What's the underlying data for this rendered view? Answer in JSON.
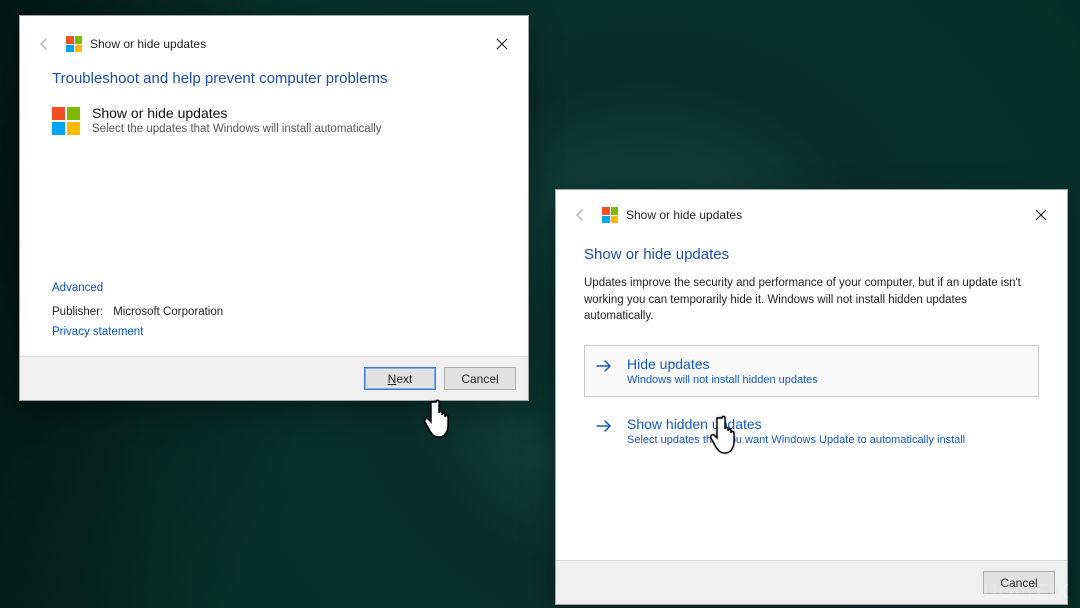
{
  "dialog1": {
    "title": "Show or hide updates",
    "heading": "Troubleshoot and help prevent computer problems",
    "section_title": "Show or hide updates",
    "section_desc": "Select the updates that Windows will install automatically",
    "advanced": "Advanced",
    "publisher_label": "Publisher:",
    "publisher_value": "Microsoft Corporation",
    "privacy": "Privacy statement",
    "next": "Next",
    "cancel": "Cancel"
  },
  "dialog2": {
    "title": "Show or hide updates",
    "heading": "Show or hide updates",
    "body": "Updates improve the security and performance of your computer, but if an update isn't working you can temporarily hide it. Windows will not install hidden updates automatically.",
    "opt1_title": "Hide updates",
    "opt1_desc": "Windows will not install hidden updates",
    "opt2_title": "Show hidden updates",
    "opt2_desc": "Select updates that you want Windows Update to automatically install",
    "cancel": "Cancel"
  },
  "watermark": "UG    FIX"
}
